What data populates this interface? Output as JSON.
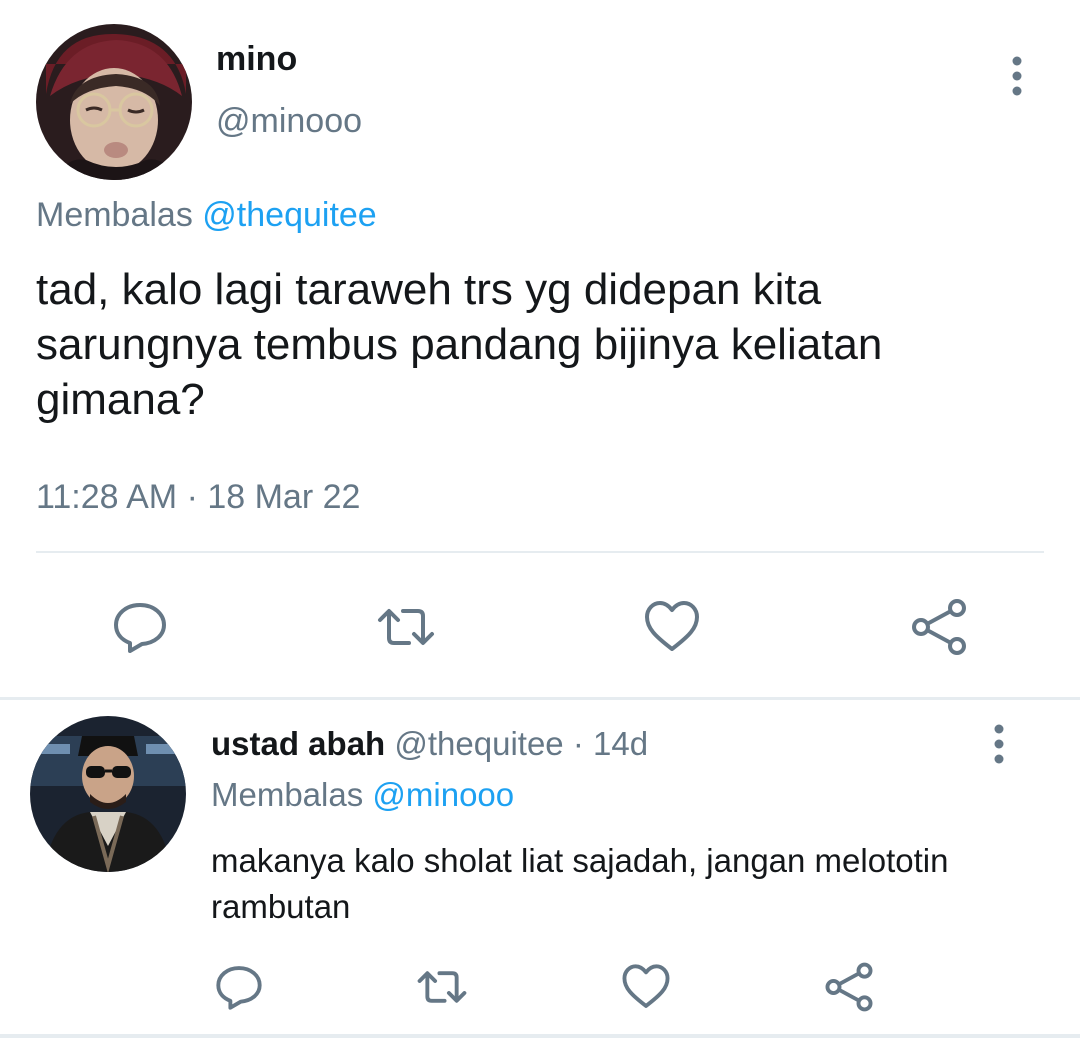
{
  "main_tweet": {
    "author_name": "mino",
    "author_handle": "@minooo",
    "reply_prefix": "Membalas",
    "reply_mention": "@thequitee",
    "text": "tad, kalo lagi taraweh trs yg didepan kita sarungnya tembus pandang bijinya keliatan gimana?",
    "timestamp": "11:28 AM · 18 Mar 22",
    "actions": [
      "reply-icon",
      "retweet-icon",
      "like-icon",
      "share-icon"
    ]
  },
  "reply_tweet": {
    "author_name": "ustad abah",
    "author_handle": "@thequitee",
    "separator": " · ",
    "age": "14d",
    "reply_prefix": "Membalas",
    "reply_mention": "@minooo",
    "text": "makanya kalo sholat liat sajadah, jangan melototin rambutan",
    "actions": [
      "reply-icon",
      "retweet-icon",
      "like-icon",
      "share-icon"
    ]
  },
  "colors": {
    "text_primary": "#14171a",
    "text_secondary": "#657786",
    "link": "#1da1f2",
    "icon": "#657786",
    "divider": "#e6ecf0"
  }
}
